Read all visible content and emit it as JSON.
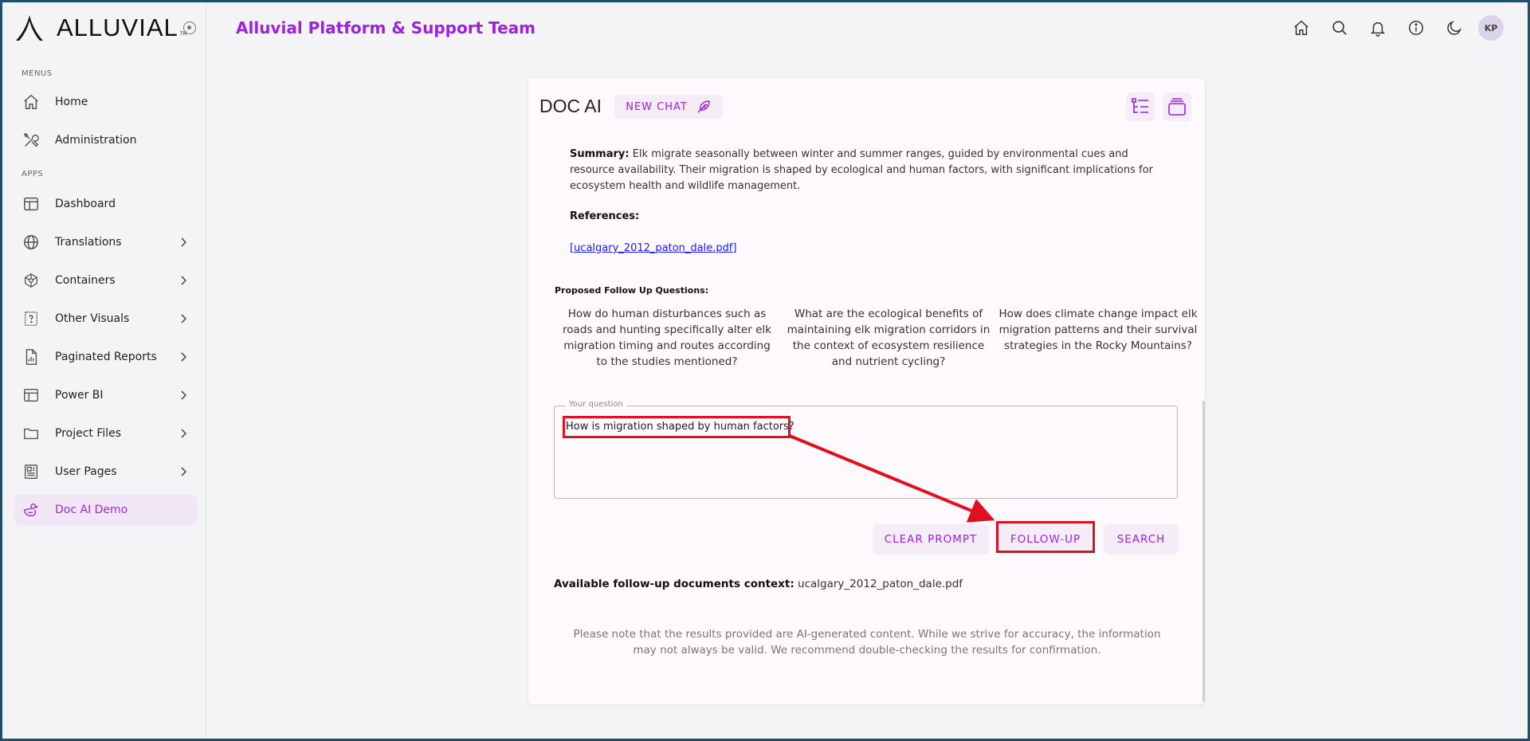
{
  "brand": {
    "name": "ALLUVIAL",
    "tm": "TM"
  },
  "sidebar": {
    "menus_label": "MENUS",
    "apps_label": "APPS",
    "menu_items": [
      {
        "label": "Home",
        "icon": "home-icon"
      },
      {
        "label": "Administration",
        "icon": "tools-icon"
      }
    ],
    "app_items": [
      {
        "label": "Dashboard",
        "icon": "dashboard-icon",
        "expandable": false
      },
      {
        "label": "Translations",
        "icon": "globe-icon",
        "expandable": true
      },
      {
        "label": "Containers",
        "icon": "network-icon",
        "expandable": true
      },
      {
        "label": "Other Visuals",
        "icon": "question-box-icon",
        "expandable": true
      },
      {
        "label": "Paginated Reports",
        "icon": "report-icon",
        "expandable": true
      },
      {
        "label": "Power BI",
        "icon": "layout-icon",
        "expandable": true
      },
      {
        "label": "Project Files",
        "icon": "folder-icon",
        "expandable": true
      },
      {
        "label": "User Pages",
        "icon": "pages-icon",
        "expandable": true
      },
      {
        "label": "Doc AI Demo",
        "icon": "duck-icon",
        "expandable": false,
        "active": true
      }
    ]
  },
  "header": {
    "title": "Alluvial Platform & Support Team",
    "avatar_initials": "KP",
    "icons": [
      "home-icon",
      "search-icon",
      "bell-icon",
      "info-icon",
      "moon-icon"
    ]
  },
  "docai": {
    "title": "DOC AI",
    "new_chat_label": "NEW CHAT",
    "summary_label": "Summary:",
    "summary_text": " Elk migrate seasonally between winter and summer ranges, guided by environmental cues and resource availability. Their migration is shaped by ecological and human factors, with significant implications for ecosystem health and wildlife management.",
    "references_label": "References:",
    "reference_link": "[ucalgary_2012_paton_dale.pdf]",
    "followups_label": "Proposed Follow Up Questions:",
    "followup_questions": [
      "How do human disturbances such as roads and hunting specifically alter elk migration timing and routes according to the studies mentioned?",
      "What are the ecological benefits of maintaining elk migration corridors in the context of ecosystem resilience and nutrient cycling?",
      "How does climate change impact elk migration patterns and their survival strategies in the Rocky Mountains?"
    ],
    "question_legend": "Your question",
    "question_value": "How is migration shaped by human factors?",
    "buttons": {
      "clear": "CLEAR PROMPT",
      "followup": "FOLLOW-UP",
      "search": "SEARCH"
    },
    "available_label": "Available follow-up documents context:",
    "available_value": " ucalgary_2012_paton_dale.pdf",
    "note": "Please note that the results provided are AI-generated content. While we strive for accuracy, the information may not always be valid. We recommend double-checking the results for confirmation."
  },
  "colors": {
    "accent": "#a020e0",
    "highlight": "#e01020",
    "active_bg": "#f0e6f6"
  }
}
